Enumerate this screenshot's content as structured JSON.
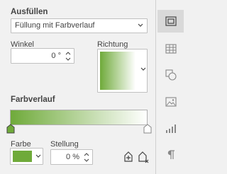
{
  "fill": {
    "heading": "Ausfüllen",
    "type_value": "Füllung mit Farbverlauf"
  },
  "angle": {
    "label": "Winkel",
    "value": "0 °"
  },
  "direction": {
    "label": "Richtung"
  },
  "gradient": {
    "heading": "Farbverlauf",
    "start_color": "#6faa3a",
    "end_color": "#ffffff"
  },
  "color": {
    "label": "Farbe",
    "value_color": "#6faa3a"
  },
  "position": {
    "label": "Stellung",
    "value": "0 %"
  },
  "actions": {
    "add_stop_icon": "add-gradient-point-icon",
    "remove_stop_icon": "remove-gradient-point-icon"
  },
  "sidebar": {
    "items": [
      {
        "icon": "slide-settings-icon",
        "active": true
      },
      {
        "icon": "table-settings-icon",
        "active": false
      },
      {
        "icon": "shape-settings-icon",
        "active": false
      },
      {
        "icon": "image-settings-icon",
        "active": false
      },
      {
        "icon": "chart-settings-icon",
        "active": false
      },
      {
        "icon": "paragraph-settings-icon",
        "active": false
      }
    ]
  }
}
